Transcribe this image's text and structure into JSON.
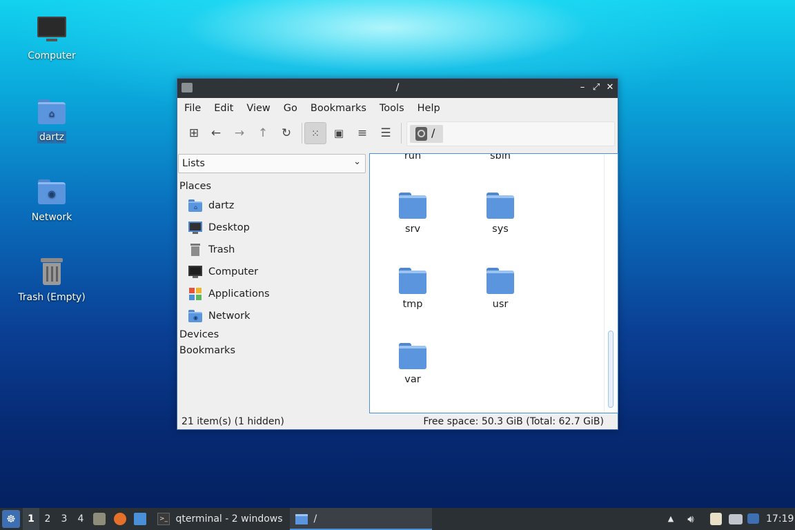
{
  "desktop": {
    "icons": [
      {
        "label": "Computer",
        "icon": "computer-icon"
      },
      {
        "label": "dartz",
        "icon": "home-folder-icon"
      },
      {
        "label": "Network",
        "icon": "network-folder-icon"
      },
      {
        "label": "Trash (Empty)",
        "icon": "trash-icon"
      }
    ]
  },
  "window": {
    "title": "/",
    "controls": {
      "minimize": "–",
      "maximize": "⤢",
      "close": "✕"
    },
    "menu": [
      "File",
      "Edit",
      "Go",
      "Bookmarks",
      "Tools",
      "Help"
    ],
    "toolbar": {
      "buttons": [
        "new-tab-icon",
        "back-arrow-icon",
        "forward-arrow-icon",
        "up-arrow-icon",
        "reload-icon",
        "icon-view-icon",
        "thumbnail-view-icon",
        "compact-view-icon",
        "detailed-list-icon"
      ],
      "active_view": "icon-view-icon",
      "path": "/"
    },
    "sidebar": {
      "mode": "Lists",
      "sections": {
        "places": "Places",
        "devices": "Devices",
        "bookmarks": "Bookmarks"
      },
      "places": [
        {
          "label": "dartz",
          "icon": "home-folder-icon"
        },
        {
          "label": "Desktop",
          "icon": "desktop-icon"
        },
        {
          "label": "Trash",
          "icon": "trash-icon"
        },
        {
          "label": "Computer",
          "icon": "computer-icon"
        },
        {
          "label": "Applications",
          "icon": "applications-icon"
        },
        {
          "label": "Network",
          "icon": "network-folder-icon"
        }
      ]
    },
    "files": {
      "partial_top": [
        "run",
        "sbin"
      ],
      "items": [
        "srv",
        "sys",
        "tmp",
        "usr",
        "var"
      ]
    },
    "status": {
      "items": "21 item(s) (1 hidden)",
      "free_space": "Free space: 50.3 GiB (Total: 62.7 GiB)"
    },
    "accent_color": "#4a90d9"
  },
  "taskbar": {
    "workspaces": [
      "1",
      "2",
      "3",
      "4"
    ],
    "current_workspace": "1",
    "launchers": [
      "file-manager-icon",
      "firefox-icon",
      "desktop-show-icon"
    ],
    "tasks": [
      {
        "label": "qterminal - 2 windows",
        "icon": "terminal-icon"
      },
      {
        "label": "/",
        "icon": "folder-icon"
      }
    ],
    "tray": [
      "tray-arrow-icon",
      "volume-icon",
      "clipboard-icon",
      "network-icon",
      "update-notifier-icon"
    ],
    "clock": "17:19"
  }
}
